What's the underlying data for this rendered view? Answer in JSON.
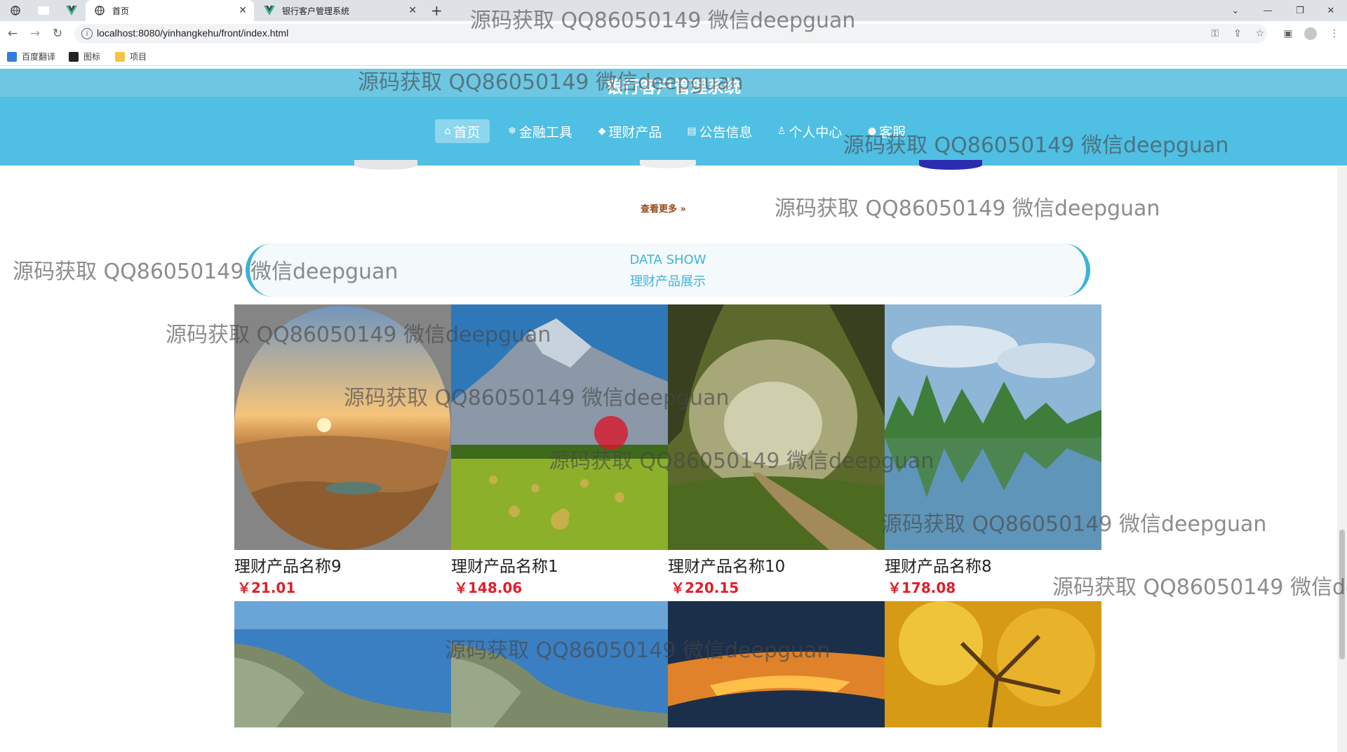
{
  "browser": {
    "tabs": [
      {
        "title": "首页",
        "active": true
      },
      {
        "title": "银行客户管理系统",
        "active": false
      }
    ],
    "url": "localhost:8080/yinhangkehu/front/index.html",
    "bookmarks": [
      "百度翻译",
      "图标",
      "项目"
    ]
  },
  "site": {
    "title": "银行客户管理系统",
    "nav": [
      {
        "label": "首页",
        "icon": "home-icon",
        "active": true
      },
      {
        "label": "金融工具",
        "icon": "gear-icon",
        "active": false
      },
      {
        "label": "理财产品",
        "icon": "graduation-cap-icon",
        "active": false
      },
      {
        "label": "公告信息",
        "icon": "document-icon",
        "active": false
      },
      {
        "label": "个人中心",
        "icon": "user-icon",
        "active": false
      },
      {
        "label": "客服",
        "icon": "chat-icon",
        "active": false
      }
    ],
    "more_link": "查看更多"
  },
  "data_show": {
    "title_en": "DATA SHOW",
    "title_cn": "理财产品展示"
  },
  "products": [
    {
      "name": "理财产品名称9",
      "price": "￥21.01",
      "scene": "desert-sunset"
    },
    {
      "name": "理财产品名称1",
      "price": "￥148.06",
      "scene": "mountain-field"
    },
    {
      "name": "理财产品名称10",
      "price": "￥220.15",
      "scene": "forest-path"
    },
    {
      "name": "理财产品名称8",
      "price": "￥178.08",
      "scene": "karst-river"
    }
  ],
  "products_row2": [
    {
      "scene": "blue-shore"
    },
    {
      "scene": "blue-shore"
    },
    {
      "scene": "sunset-clouds"
    },
    {
      "scene": "golden-tree"
    }
  ],
  "watermark": "源码获取 QQ86050149 微信deepguan",
  "colors": {
    "nav_bg": "#4fbfe3",
    "accent": "#43b4d8",
    "price": "#e01e2a"
  }
}
